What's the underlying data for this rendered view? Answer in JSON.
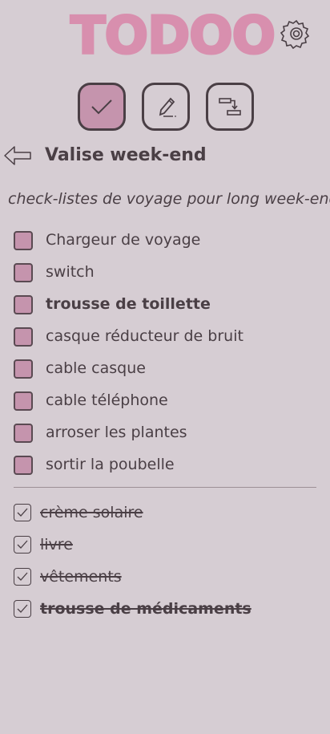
{
  "app": {
    "logo_text": "TODOO"
  },
  "header": {
    "settings_icon": "gear-icon",
    "modes": [
      {
        "icon": "checkmark-icon",
        "active": true
      },
      {
        "icon": "pencil-icon",
        "active": false
      },
      {
        "icon": "reorder-icon",
        "active": false
      }
    ]
  },
  "list": {
    "back_icon": "arrow-left-icon",
    "title": "Valise week-end",
    "description": "check-listes de voyage pour long week-end"
  },
  "todo_items": [
    {
      "label": "Chargeur de voyage",
      "bold": false
    },
    {
      "label": "switch",
      "bold": false
    },
    {
      "label": "trousse de toillette",
      "bold": true
    },
    {
      "label": "casque réducteur de bruit",
      "bold": false
    },
    {
      "label": "cable casque",
      "bold": false
    },
    {
      "label": "cable téléphone",
      "bold": false
    },
    {
      "label": "arroser les plantes",
      "bold": false
    },
    {
      "label": "sortir la poubelle",
      "bold": false
    }
  ],
  "done_items": [
    {
      "label": "crème solaire",
      "bold": false
    },
    {
      "label": "livre",
      "bold": false
    },
    {
      "label": "vêtements",
      "bold": false
    },
    {
      "label": "trousse de médicaments",
      "bold": true
    }
  ],
  "colors": {
    "background": "#d6cdd3",
    "accent": "#c594ad",
    "logo": "#d88fae",
    "text": "#4a3f45"
  }
}
